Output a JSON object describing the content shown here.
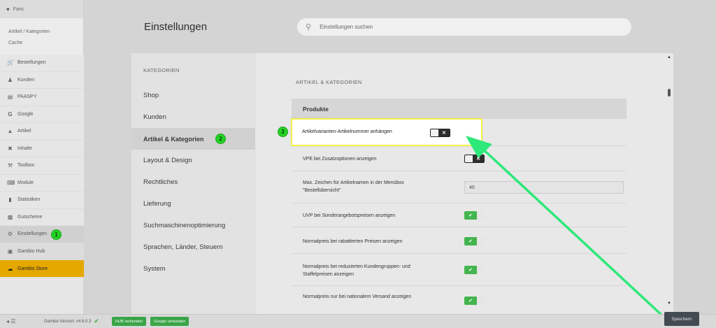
{
  "app": {
    "brand": "Favs",
    "recent_links": [
      "Artikel / Kategorien",
      "Cache"
    ]
  },
  "sidebar": {
    "items": [
      {
        "label": "Bestellungen",
        "icon": "cart-icon"
      },
      {
        "label": "Kunden",
        "icon": "users-icon"
      },
      {
        "label": "PAASPY",
        "icon": "card-icon"
      },
      {
        "label": "Google",
        "icon": "google-icon"
      },
      {
        "label": "Artikel",
        "icon": "hierarchy-icon"
      },
      {
        "label": "Inhalte",
        "icon": "tools-icon"
      },
      {
        "label": "Toolbox",
        "icon": "wrench-icon"
      },
      {
        "label": "Module",
        "icon": "plug-icon"
      },
      {
        "label": "Statistiken",
        "icon": "chart-icon"
      },
      {
        "label": "Gutscheine",
        "icon": "gift-icon"
      },
      {
        "label": "Einstellungen",
        "icon": "gears-icon"
      },
      {
        "label": "Gambio Hub",
        "icon": "hub-icon"
      },
      {
        "label": "Gambio Store",
        "icon": "cloud-icon"
      }
    ]
  },
  "header": {
    "title": "Einstellungen",
    "search_placeholder": "Einstellungen suchen"
  },
  "categories": {
    "heading": "KATEGORIEN",
    "items": [
      "Shop",
      "Kunden",
      "Artikel & Kategorien",
      "Layout & Design",
      "Rechtliches",
      "Lieferung",
      "Suchmaschinenoptimierung",
      "Sprachen, Länder, Steuern",
      "System"
    ]
  },
  "content": {
    "section_title": "ARTIKEL & KATEGORIEN",
    "group_title": "Produkte",
    "highlighted_setting": "Artikelvarianten-Artikelnummer anhängen",
    "settings": [
      {
        "label": "VPE bei Zusatzoptionen anzeigen"
      },
      {
        "label": "Max. Zeichen für Artikelnamen in der Menübox \"Bestellübersicht\"",
        "value": "40"
      },
      {
        "label": "UVP bei Sonderangebotspreisen anzeigen"
      },
      {
        "label": "Normalpreis bei rabattierten Preisen anzeigen"
      },
      {
        "label": "Normalpreis bei reduzierten Kundengruppen- und Staffelpreisen anzeigen"
      },
      {
        "label": "Normalpreis nur bei nationalem Versand anzeigen"
      }
    ]
  },
  "annotations": {
    "step1": "1",
    "step2": "2",
    "step3": "3"
  },
  "footer": {
    "version": "Gambio Version: v4.6.0.3",
    "hub_status": "HUB verbunden",
    "google_status": "Google verbunden",
    "save_label": "Speichern"
  },
  "colors": {
    "accent_green": "#44b54e",
    "store_yellow": "#e5a800",
    "highlight": "#f4f24a",
    "arrow": "#2ee87a"
  }
}
